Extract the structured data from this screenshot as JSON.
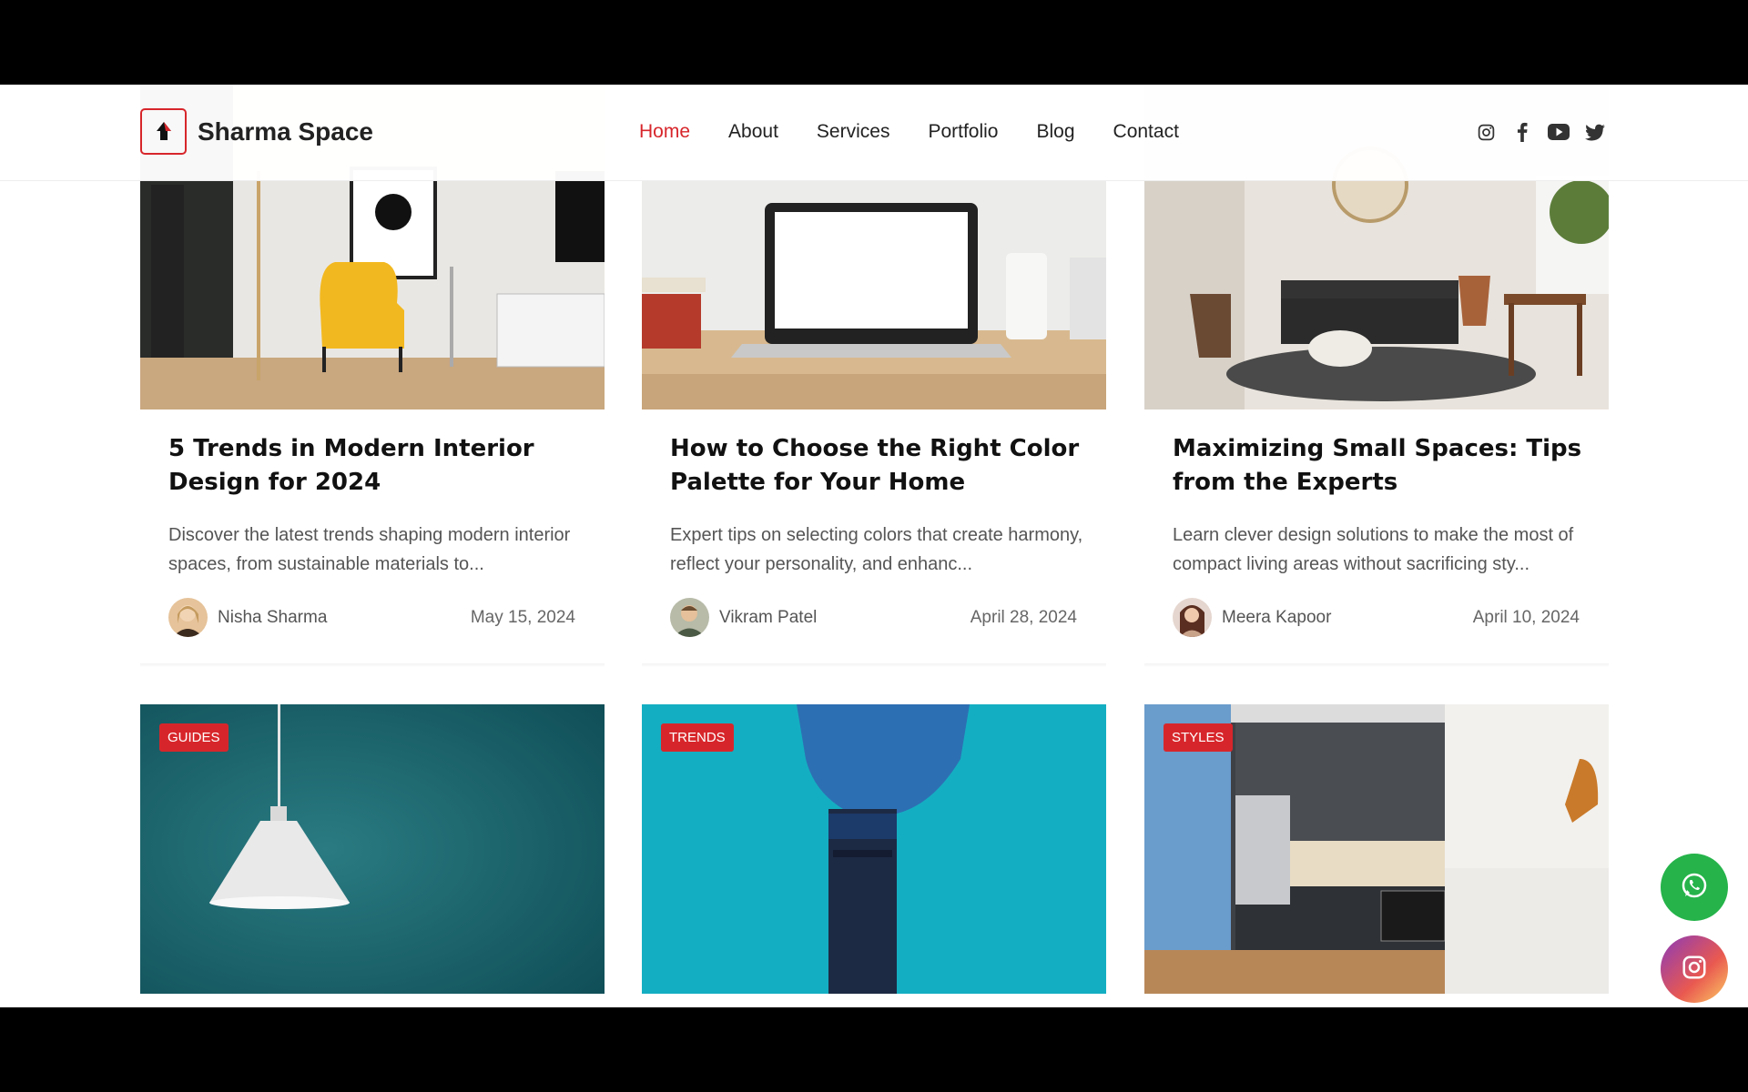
{
  "brand": {
    "name": "Sharma Space",
    "accent": "#d7262b"
  },
  "nav": {
    "items": [
      "Home",
      "About",
      "Services",
      "Portfolio",
      "Blog",
      "Contact"
    ],
    "active": "Home"
  },
  "socials": [
    "instagram-icon",
    "facebook-icon",
    "youtube-icon",
    "twitter-icon"
  ],
  "posts": [
    {
      "title": "5 Trends in Modern Interior Design for 2024",
      "excerpt": "Discover the latest trends shaping modern interior spaces, from sustainable materials to...",
      "author": "Nisha Sharma",
      "date": "May 15, 2024"
    },
    {
      "title": "How to Choose the Right Color Palette for Your Home",
      "excerpt": "Expert tips on selecting colors that create harmony, reflect your personality, and enhanc...",
      "author": "Vikram Patel",
      "date": "April 28, 2024"
    },
    {
      "title": "Maximizing Small Spaces: Tips from the Experts",
      "excerpt": "Learn clever design solutions to make the most of compact living areas without sacrificing sty...",
      "author": "Meera Kapoor",
      "date": "April 10, 2024"
    }
  ],
  "lower_posts": [
    {
      "category": "GUIDES"
    },
    {
      "category": "TRENDS"
    },
    {
      "category": "STYLES"
    }
  ],
  "floating": {
    "whatsapp_color": "#25b34a",
    "instagram_color": "#c83aa3"
  }
}
